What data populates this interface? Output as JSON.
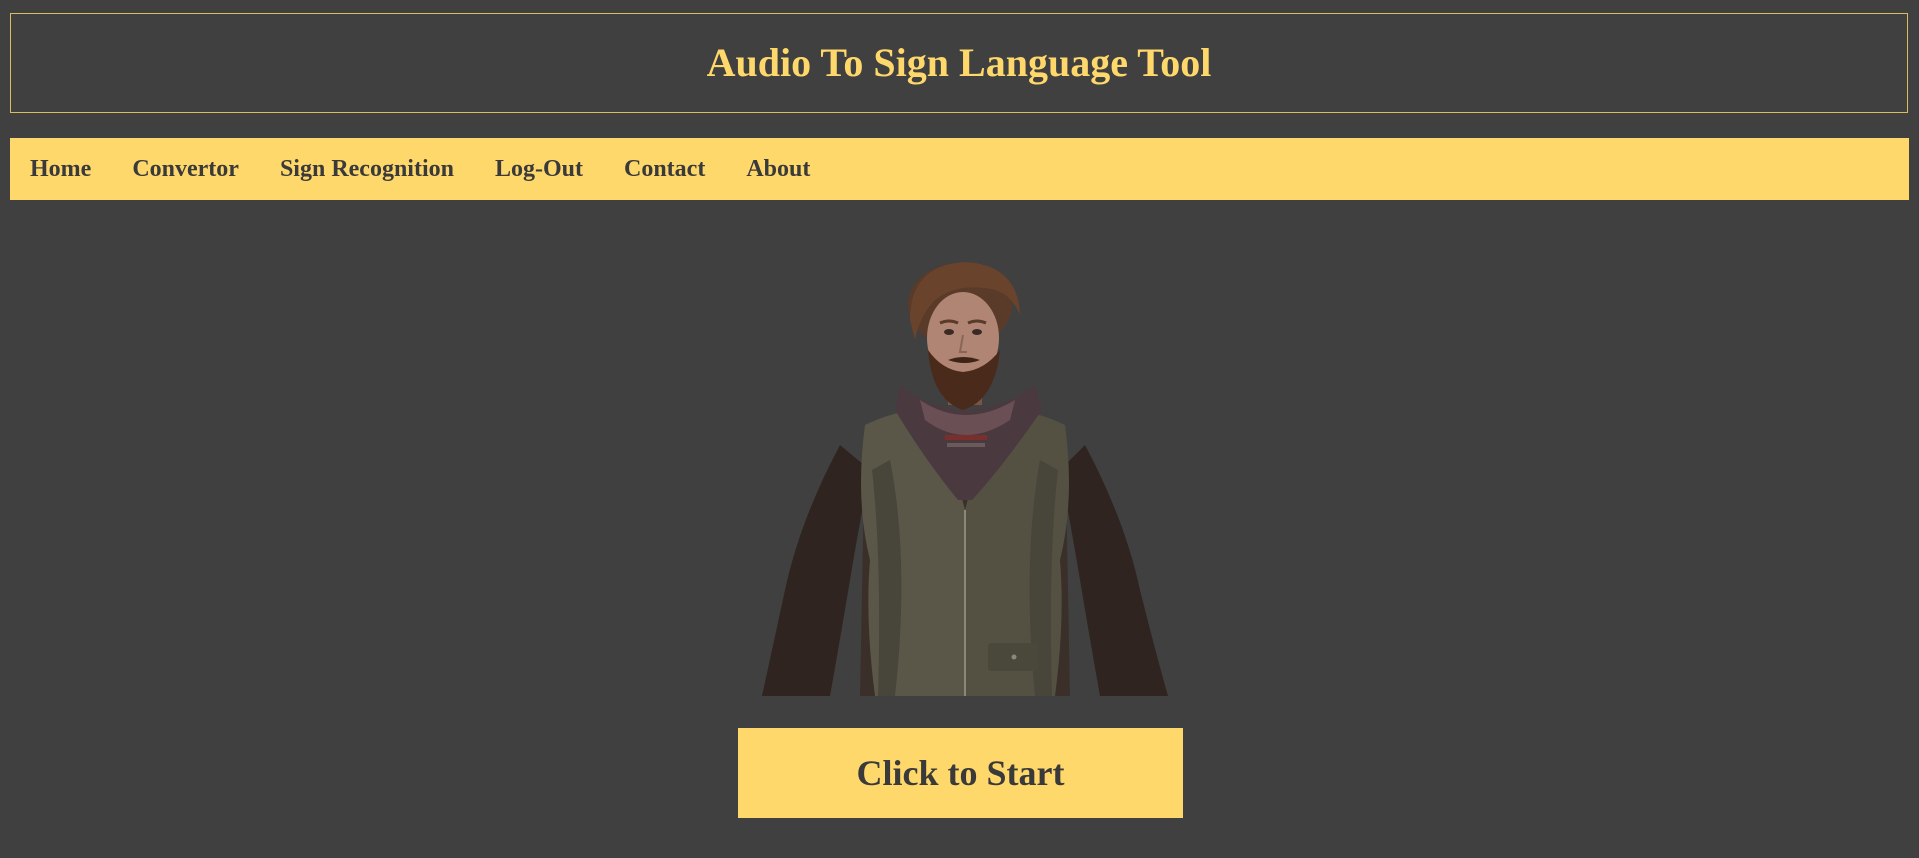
{
  "header": {
    "title": "Audio To Sign Language Tool"
  },
  "nav": {
    "items": [
      {
        "label": "Home"
      },
      {
        "label": "Convertor"
      },
      {
        "label": "Sign Recognition"
      },
      {
        "label": "Log-Out"
      },
      {
        "label": "Contact"
      },
      {
        "label": "About"
      }
    ]
  },
  "main": {
    "start_button_label": "Click to Start"
  },
  "colors": {
    "background": "#404040",
    "accent": "#ffd86b",
    "nav_text": "#3a3a3a"
  }
}
